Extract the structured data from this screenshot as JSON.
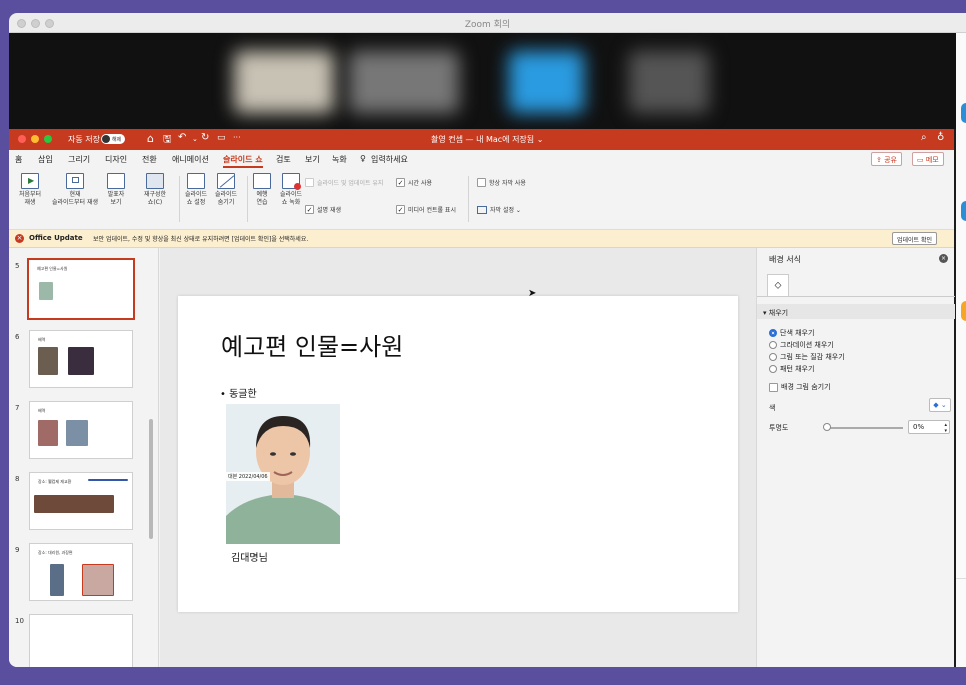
{
  "zoom": {
    "title": "Zoom 회의"
  },
  "ppt": {
    "autosave_label": "자동 저장",
    "autosave_state": "해제",
    "doc_title": "촬영 컨셉 — 내 Mac에 저장됨 ⌄",
    "more": "···"
  },
  "menu": {
    "items": [
      "홈",
      "삽입",
      "그리기",
      "디자인",
      "전환",
      "애니메이션",
      "슬라이드 쇼",
      "검토",
      "보기",
      "녹화"
    ],
    "active": "슬라이드 쇼",
    "search": "입력하세요",
    "share": "공유",
    "comments": "메모"
  },
  "ribbon": {
    "from_start": [
      "처음부터",
      "재생"
    ],
    "from_current": [
      "현재",
      "슬라이드부터 재생"
    ],
    "presenter": [
      "발표자",
      "보기"
    ],
    "custom": [
      "재구성한",
      "쇼(C)"
    ],
    "setup": [
      "슬라이드",
      "쇼 설정"
    ],
    "hide": [
      "슬라이드",
      "숨기기"
    ],
    "rehearse": [
      "예행",
      "연습"
    ],
    "record": [
      "슬라이드",
      "쇼 녹화"
    ],
    "keep_updated": "슬라이드 및 업데이트 유지",
    "use_timings": "시간 사용",
    "play_narrations": "설명 재생",
    "media_controls": "미디어 컨트롤 표시",
    "always_subtitles": "항상 자막 사용",
    "subtitle_settings": "자막 설정 ⌄"
  },
  "update_bar": {
    "title": "Office Update",
    "message": "보안 업데이트, 수정 및 향상을 최신 상태로 유지하려면 [업데이트 확인]을 선택하세요.",
    "button": "업데이트 확인"
  },
  "thumbnails": [
    {
      "num": "5",
      "title": "예고편 인물=사원",
      "selected": true
    },
    {
      "num": "6",
      "title": "배역"
    },
    {
      "num": "7",
      "title": "배역"
    },
    {
      "num": "8",
      "title": "장소: 웰컴제 재교환"
    },
    {
      "num": "9",
      "title": "장소: 대리원, 과장편"
    },
    {
      "num": "10",
      "title": ""
    }
  ],
  "slide": {
    "title": "예고편 인물=사원",
    "bullet": "동글한",
    "photo_stamp": "대본 2022/04/06",
    "caption": "김대명님"
  },
  "format_pane": {
    "title": "배경 서식",
    "section": "채우기",
    "options": [
      "단색 채우기",
      "그라데이션 채우기",
      "그림 또는 질감 채우기",
      "패턴 채우기"
    ],
    "selected_option": "단색 채우기",
    "hide_bg": "배경 그림 숨기기",
    "color_label": "색",
    "transparency_label": "투명도",
    "transparency_value": "0%"
  },
  "colors": {
    "ppt_red": "#c63a1f",
    "accent_blue": "#2b6fd6"
  }
}
